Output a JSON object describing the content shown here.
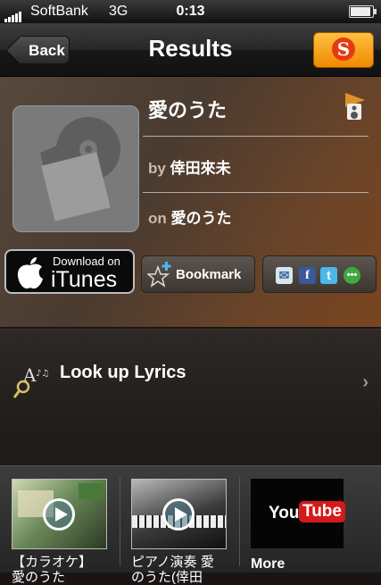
{
  "status_bar": {
    "carrier": "SoftBank",
    "network": "3G",
    "time": "0:13",
    "battery_level": 0.9
  },
  "nav": {
    "back_label": "Back",
    "title": "Results",
    "shazam_icon": "shazam-logo-icon"
  },
  "track": {
    "title": "愛のうた",
    "by_prefix": "by",
    "artist": "倖田來未",
    "on_prefix": "on",
    "album": "愛のうた"
  },
  "actions": {
    "itunes_small": "Download on",
    "itunes_big": "iTunes",
    "bookmark_label": "Bookmark",
    "share_icons": [
      "mail-icon",
      "facebook-icon",
      "twitter-icon",
      "sms-icon"
    ]
  },
  "lyrics": {
    "label": "Look up Lyrics"
  },
  "videos": {
    "items": [
      {
        "title": "【カラオケ】",
        "title2": "愛のうた"
      },
      {
        "title": "ピアノ演奏 愛",
        "title2": "のうた(倖田"
      }
    ],
    "youtube_you": "You",
    "youtube_tube": "Tube",
    "more_label": "More"
  },
  "colors": {
    "shazam_orange": "#f5a020",
    "youtube_red": "#d41a1a"
  }
}
